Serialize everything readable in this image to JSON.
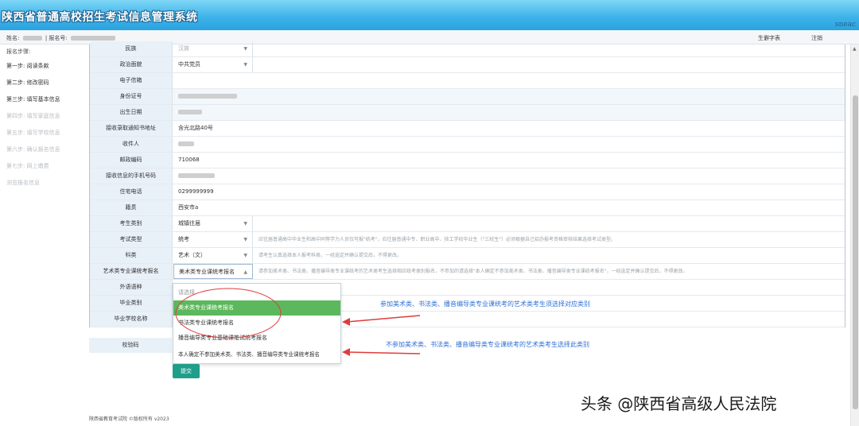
{
  "header": {
    "title": "陕西省普通高校招生考试信息管理系统",
    "brand": "sneac"
  },
  "userbar": {
    "name_label": "姓名:",
    "reg_label": "| 报名号:",
    "link_dict": "生僻字表",
    "link_logout": "注销"
  },
  "sidebar": {
    "heading": "报名步骤:",
    "steps": [
      {
        "label": "第一步: 阅读条款",
        "enabled": true
      },
      {
        "label": "第二步: 修改密码",
        "enabled": true
      },
      {
        "label": "第三步: 填写基本信息",
        "enabled": true
      },
      {
        "label": "第四步: 填写家庭信息",
        "enabled": false
      },
      {
        "label": "第五步: 填写学校信息",
        "enabled": false
      },
      {
        "label": "第六步: 确认报名信息",
        "enabled": false
      },
      {
        "label": "第七步: 网上缴费",
        "enabled": false
      },
      {
        "label": "浏览报名信息",
        "enabled": false
      }
    ]
  },
  "form": {
    "rows": [
      {
        "label": "民族",
        "value": "汉族",
        "select": true
      },
      {
        "label": "政治面貌",
        "value": "中共党员",
        "select": true
      },
      {
        "label": "电子信箱",
        "value": ""
      },
      {
        "label": "身份证号",
        "value": "",
        "redacted": true
      },
      {
        "label": "出生日期",
        "value": "",
        "redacted": true
      },
      {
        "label": "接收录取通知书地址",
        "value": "含光北路40号"
      },
      {
        "label": "收件人",
        "value": "",
        "redacted": true
      },
      {
        "label": "邮政编码",
        "value": "710068"
      },
      {
        "label": "接收信息的手机号码",
        "value": "",
        "redacted": true
      },
      {
        "label": "住宅电话",
        "value": "0299999999"
      },
      {
        "label": "籍贯",
        "value": "西安市a"
      },
      {
        "label": "考生类别",
        "value": "城镇往届",
        "select": true
      },
      {
        "label": "考试类型",
        "value": "统考",
        "select": true,
        "hint": "应往届普通高中毕业生和高中同等学力人员仅可报\"统考\"，应往届普通中专、职业高中、技工学校毕业生（\"三校生\"）必须根据自己招办报考资格审核结果选择考试类型。"
      },
      {
        "label": "科类",
        "value": "艺术（文）",
        "select": true,
        "hint": "请考生认真选择本人报考科类，一经选定并确认提交后，不得更改。"
      },
      {
        "label": "艺术类专业课统考报名",
        "value": "美术类专业课统考报名",
        "select": true,
        "open": true,
        "hint": "请参加美术类、书法类、播音编导类专业课统考的艺术类考生选择相应统考类别报名，不参加的请选择\"本人确定不参加美术类、书法类、播音编导类专业课统考报名\"，一经选定并确认提交后，不得更改。"
      },
      {
        "label": "外语语种",
        "value": ""
      },
      {
        "label": "毕业类别",
        "value": ""
      },
      {
        "label": "毕业学校名称",
        "value": ""
      }
    ],
    "verify_label": "校验码",
    "submit_label": "提交"
  },
  "dropdown": {
    "placeholder": "请选择",
    "options": [
      "美术类专业课统考报名",
      "书法类专业课统考报名",
      "播音编导类专业基础课笔试统考报名",
      "本人确定不参加美术类、书法类、播音编导类专业课统考报名"
    ],
    "selected_index": 0
  },
  "annotations": {
    "note_top": "参加美术类、书法类、播音编导类专业课统考的艺术类考生须选择对应类别",
    "note_bottom": "不参加美术类、书法类、播音编导类专业课统考的艺术类考生选择此类别",
    "color": "#2e6fd6",
    "arrow_color": "#e03c3c"
  },
  "footer": {
    "text": "陕西省教育考试院 ©版权所有 v2023"
  },
  "watermark": {
    "text": "头条 @陕西省高级人民法院"
  }
}
